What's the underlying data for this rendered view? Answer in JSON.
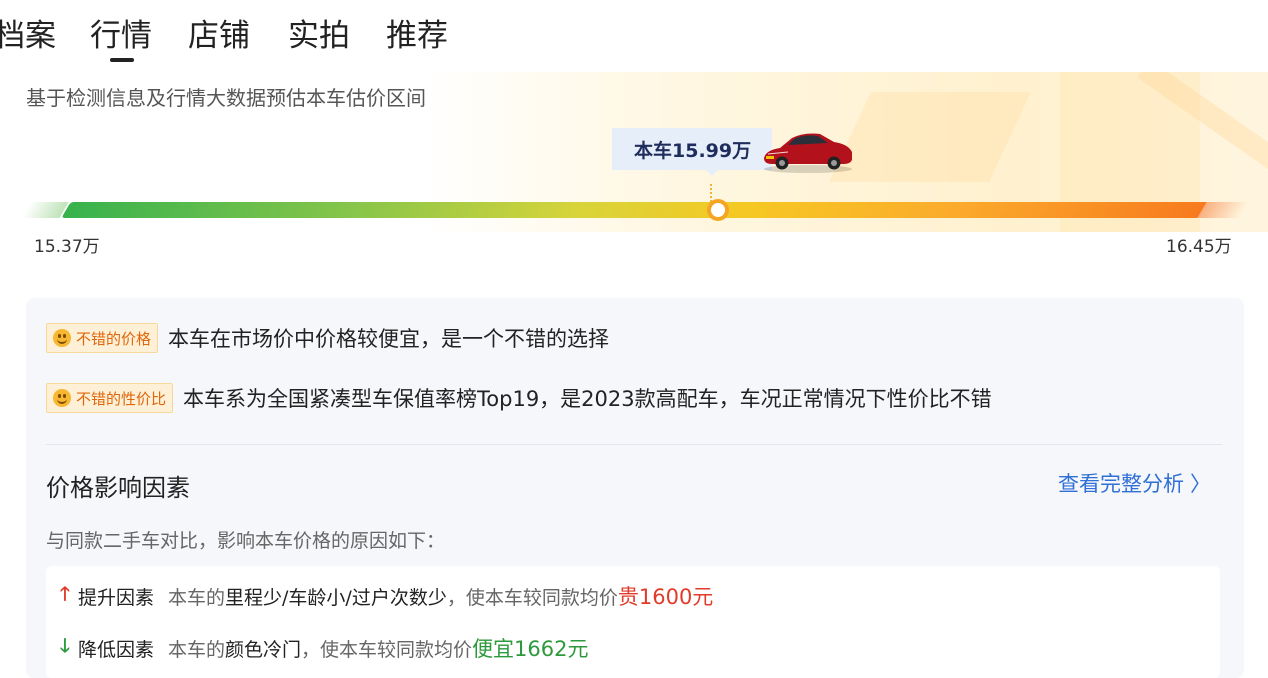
{
  "tabs": [
    {
      "label": "档案"
    },
    {
      "label": "行情",
      "active": true
    },
    {
      "label": "店铺"
    },
    {
      "label": "实拍"
    },
    {
      "label": "推荐"
    }
  ],
  "estimate": {
    "description": "基于检测信息及行情大数据预估本车估价区间",
    "current_price_label": "本车15.99万",
    "range_low": "15.37万",
    "range_high": "16.45万",
    "marker_position_fraction": 0.573,
    "bar_colors": [
      "#37b24d",
      "#d8d43a",
      "#f6c822",
      "#f77a1e"
    ]
  },
  "comments": [
    {
      "tag": "不错的价格",
      "icon": "smile-icon",
      "text": "本车在市场价中价格较便宜，是一个不错的选择"
    },
    {
      "tag": "不错的性价比",
      "icon": "smile-icon",
      "text": "本车系为全国紧凑型车保值率榜Top19，是2023款高配车，车况正常情况下性价比不错"
    }
  ],
  "factors": {
    "title": "价格影响因素",
    "link": "查看完整分析",
    "description": "与同款二手车对比，影响本车价格的原因如下：",
    "items": [
      {
        "direction": "up",
        "icon": "arrow-up-icon",
        "label": "提升因素",
        "prefix": "本车的",
        "highlight": "里程少/车龄小/过户次数少",
        "middle": "，使本车较同款均价",
        "result": "贵1600元",
        "color": "#e23b2a"
      },
      {
        "direction": "down",
        "icon": "arrow-down-icon",
        "label": "降低因素",
        "prefix": "本车的",
        "highlight": "颜色冷门",
        "middle": "，使本车较同款均价",
        "result": "便宜1662元",
        "color": "#2c9a3c"
      }
    ]
  }
}
